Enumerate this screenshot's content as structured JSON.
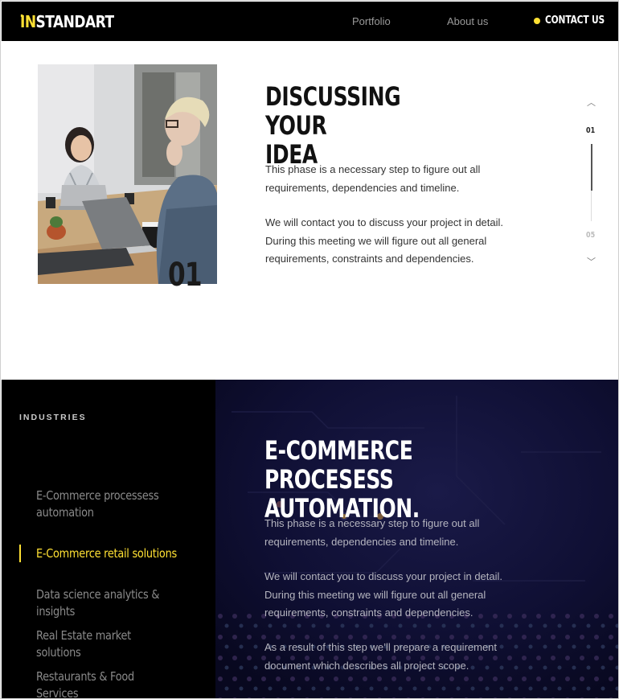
{
  "header": {
    "logo": {
      "prefix": "IN",
      "rest": "STANDART"
    },
    "nav": {
      "portfolio": "Portfolio",
      "about": "About us",
      "contact": "CONTACT US"
    }
  },
  "phase": {
    "number": "01",
    "title_line1": "DISCUSSING YOUR",
    "title_line2": "IDEA",
    "paragraph1": "This phase is a necessary step to figure out all requirements, dependencies and timeline.",
    "paragraph2": "We will contact you to discuss your project in detail. During this meeting we will figure out all general requirements, constraints and dependencies.",
    "pager": {
      "current": "01",
      "total": "05",
      "up_icon": "chevron-up-icon",
      "down_icon": "chevron-down-icon",
      "progress": 0.2
    }
  },
  "industries": {
    "label": "INDUSTRIES",
    "items": [
      {
        "line1": "E-Commerce processess",
        "line2": "automation"
      },
      {
        "line1": "E-Commerce retail solutions",
        "line2": ""
      },
      {
        "line1": "Data science analytics & insights",
        "line2": ""
      },
      {
        "line1": "Real Estate market solutions",
        "line2": ""
      },
      {
        "line1": "Restaurants & Food Services",
        "line2": ""
      }
    ],
    "active_index": 1,
    "detail": {
      "title_line1": "E-COMMERCE PROCESESS",
      "title_line2": "AUTOMATION.",
      "paragraph1": "This phase is a necessary step to figure out all requirements, dependencies and timeline.",
      "paragraph2": "We will contact you to discuss your project in detail. During this meeting we will figure out all general requirements, constraints and dependencies.",
      "paragraph3": "As a result of this step we’ll prepare a requirement document which describes all project scope."
    }
  },
  "colors": {
    "accent": "#ffe033",
    "header_bg": "#000000",
    "dark_bg": "#000000",
    "panel_bg": "#0b0b2a"
  }
}
